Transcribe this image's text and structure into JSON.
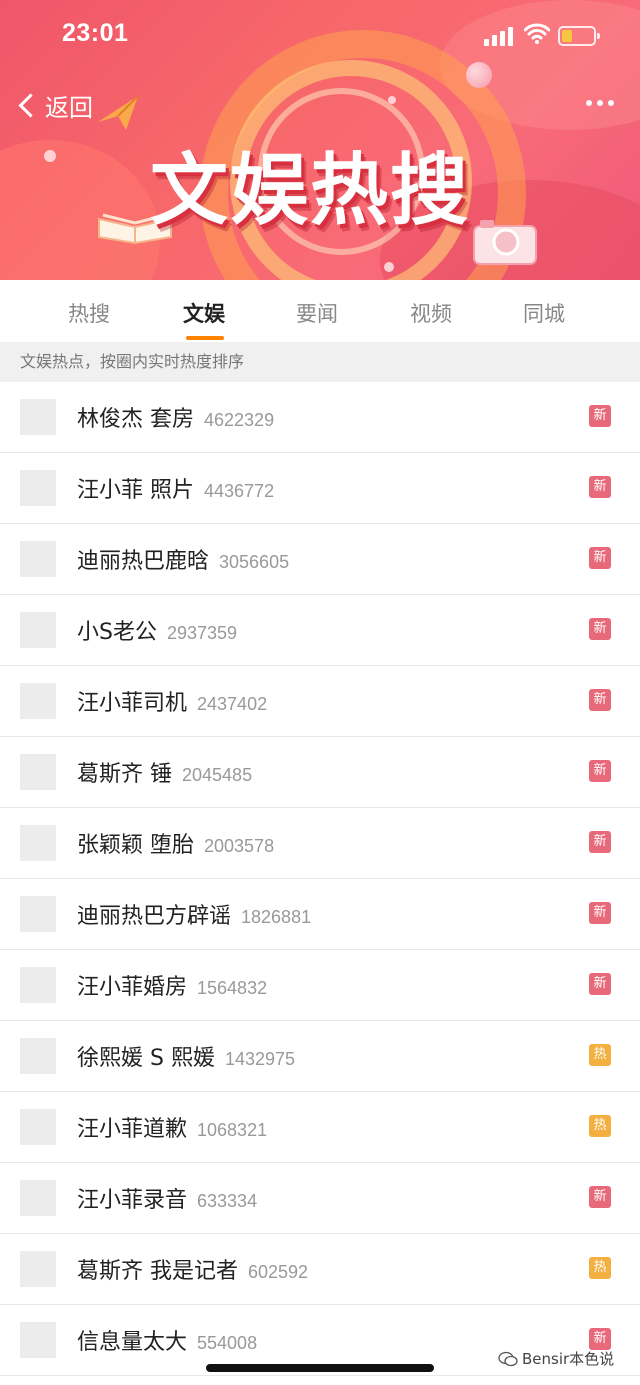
{
  "status_bar": {
    "time": "23:01"
  },
  "nav": {
    "back_label": "返回"
  },
  "banner": {
    "title": "文娱热搜"
  },
  "tabs": [
    {
      "label": "热搜",
      "active": false
    },
    {
      "label": "文娱",
      "active": true
    },
    {
      "label": "要闻",
      "active": false
    },
    {
      "label": "视频",
      "active": false
    },
    {
      "label": "同城",
      "active": false
    }
  ],
  "notice": "文娱热点，按圈内实时热度排序",
  "colors": {
    "accent": "#ff8200",
    "badge_new": "#e86a7a",
    "badge_hot": "#f3b040"
  },
  "list": [
    {
      "title": "林俊杰 套房",
      "count": "4622329",
      "badge": "新",
      "badge_type": "new"
    },
    {
      "title": "汪小菲 照片",
      "count": "4436772",
      "badge": "新",
      "badge_type": "new"
    },
    {
      "title": "迪丽热巴鹿晗",
      "count": "3056605",
      "badge": "新",
      "badge_type": "new"
    },
    {
      "title": "小S老公",
      "count": "2937359",
      "badge": "新",
      "badge_type": "new"
    },
    {
      "title": "汪小菲司机",
      "count": "2437402",
      "badge": "新",
      "badge_type": "new"
    },
    {
      "title": "葛斯齐 锤",
      "count": "2045485",
      "badge": "新",
      "badge_type": "new"
    },
    {
      "title": "张颖颖 堕胎",
      "count": "2003578",
      "badge": "新",
      "badge_type": "new"
    },
    {
      "title": "迪丽热巴方辟谣",
      "count": "1826881",
      "badge": "新",
      "badge_type": "new"
    },
    {
      "title": "汪小菲婚房",
      "count": "1564832",
      "badge": "新",
      "badge_type": "new"
    },
    {
      "title": "徐熙媛 S 熙媛",
      "count": "1432975",
      "badge": "热",
      "badge_type": "hot"
    },
    {
      "title": "汪小菲道歉",
      "count": "1068321",
      "badge": "热",
      "badge_type": "hot"
    },
    {
      "title": "汪小菲录音",
      "count": "633334",
      "badge": "新",
      "badge_type": "new"
    },
    {
      "title": "葛斯齐 我是记者",
      "count": "602592",
      "badge": "热",
      "badge_type": "hot"
    },
    {
      "title": "信息量太大",
      "count": "554008",
      "badge": "新",
      "badge_type": "new"
    }
  ],
  "watermark": "Bensir本色说"
}
